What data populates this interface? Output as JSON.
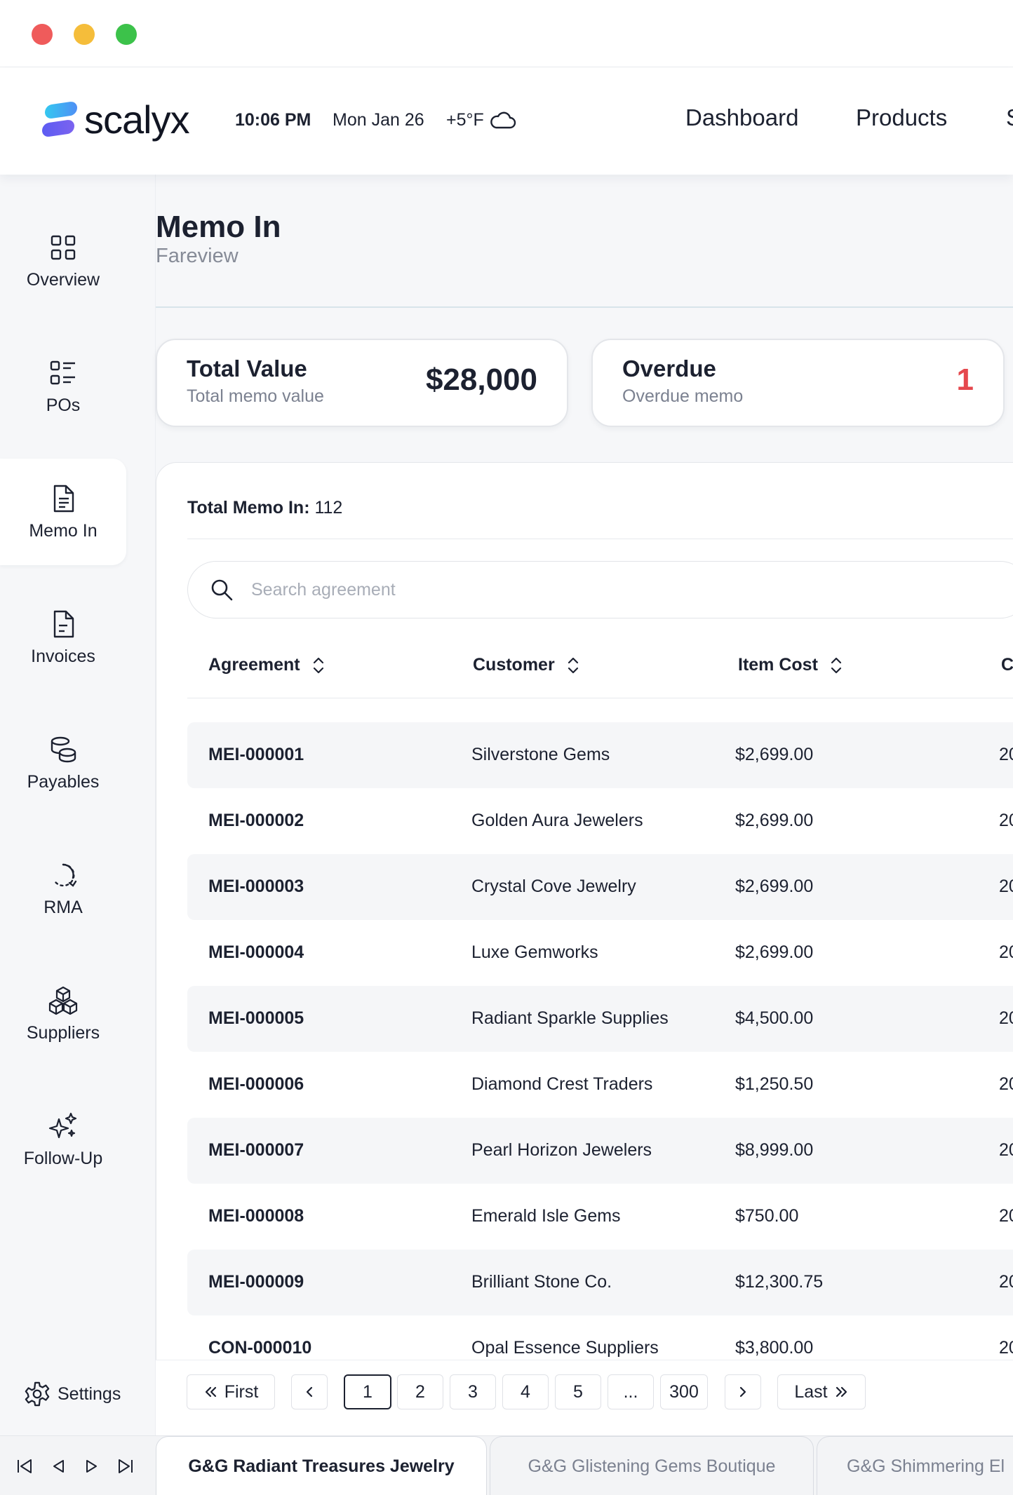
{
  "header": {
    "brand": "scalyx",
    "time": "10:06 PM",
    "date": "Mon Jan 26",
    "temperature": "+5°F",
    "weather_icon": "cloud-icon",
    "nav": [
      "Dashboard",
      "Products",
      "S"
    ]
  },
  "sidebar": {
    "items": [
      {
        "label": "Overview",
        "icon": "grid-icon"
      },
      {
        "label": "POs",
        "icon": "list-icon"
      },
      {
        "label": "Memo In",
        "icon": "document-icon",
        "active": true
      },
      {
        "label": "Invoices",
        "icon": "invoice-icon"
      },
      {
        "label": "Payables",
        "icon": "coins-icon"
      },
      {
        "label": "RMA",
        "icon": "return-icon"
      },
      {
        "label": "Suppliers",
        "icon": "boxes-icon"
      },
      {
        "label": "Follow-Up",
        "icon": "sparkles-icon"
      }
    ],
    "settings_label": "Settings"
  },
  "page": {
    "title": "Memo In",
    "subtitle": "Fareview"
  },
  "cards": {
    "total_value": {
      "title": "Total Value",
      "subtitle": "Total memo value",
      "value": "$28,000"
    },
    "overdue": {
      "title": "Overdue",
      "subtitle": "Overdue memo",
      "value": "1"
    }
  },
  "table": {
    "total_label": "Total Memo In:",
    "total_count": "112",
    "search_placeholder": "Search agreement",
    "columns": [
      "Agreement",
      "Customer",
      "Item Cost",
      "C"
    ],
    "rows": [
      {
        "agreement": "MEI-000001",
        "customer": "Silverstone Gems",
        "cost": "$2,699.00",
        "date": "20"
      },
      {
        "agreement": "MEI-000002",
        "customer": "Golden Aura Jewelers",
        "cost": "$2,699.00",
        "date": "20"
      },
      {
        "agreement": "MEI-000003",
        "customer": "Crystal Cove Jewelry",
        "cost": "$2,699.00",
        "date": "20"
      },
      {
        "agreement": "MEI-000004",
        "customer": "Luxe Gemworks",
        "cost": "$2,699.00",
        "date": "20"
      },
      {
        "agreement": "MEI-000005",
        "customer": "Radiant Sparkle Supplies",
        "cost": "$4,500.00",
        "date": "20"
      },
      {
        "agreement": "MEI-000006",
        "customer": "Diamond Crest Traders",
        "cost": "$1,250.50",
        "date": "20"
      },
      {
        "agreement": "MEI-000007",
        "customer": "Pearl Horizon Jewelers",
        "cost": "$8,999.00",
        "date": "20"
      },
      {
        "agreement": "MEI-000008",
        "customer": "Emerald Isle Gems",
        "cost": "$750.00",
        "date": "20"
      },
      {
        "agreement": "MEI-000009",
        "customer": "Brilliant Stone Co.",
        "cost": "$12,300.75",
        "date": "20"
      },
      {
        "agreement": "CON-000010",
        "customer": "Opal Essence Suppliers",
        "cost": "$3,800.00",
        "date": "20"
      }
    ]
  },
  "pagination": {
    "first": "First",
    "last": "Last",
    "pages": [
      "1",
      "2",
      "3",
      "4",
      "5",
      "...",
      "300"
    ],
    "current": "1"
  },
  "tabs": [
    "G&G Radiant Treasures Jewelry",
    "G&G Glistening Gems Boutique",
    "G&G Shimmering El"
  ],
  "colors": {
    "accent_red": "#e5484d",
    "text_dark": "#1c2130",
    "muted": "#7b8190"
  }
}
